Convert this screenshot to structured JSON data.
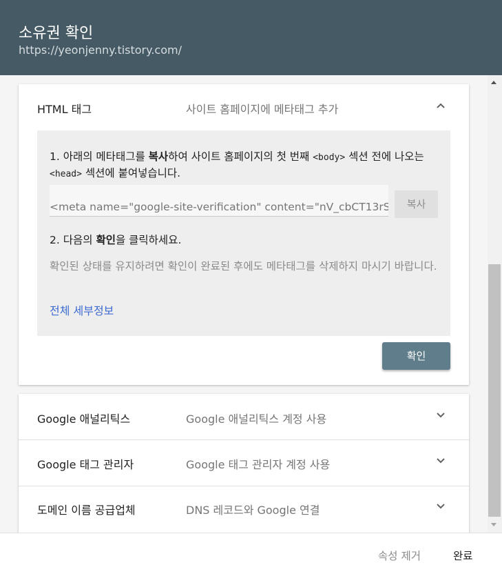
{
  "header": {
    "title": "소유권 확인",
    "url": "https://yeonjenny.tistory.com/"
  },
  "html_tag": {
    "name": "HTML 태그",
    "desc": "사이트 홈페이지에 메타태그 추가",
    "step1_a": "1. 아래의 메타태그를 ",
    "step1_bold": "복사",
    "step1_b": "하여 사이트 홈페이지의 첫 번째 ",
    "step1_code1": "<body>",
    "step1_c": " 섹션 전에 나오는 ",
    "step1_code2": "<head>",
    "step1_d": " 섹션에 붙여넣습니다.",
    "meta_value": "<meta name=\"google-site-verification\" content=\"nV_cbCT13rS",
    "copy_label": "복사",
    "step2_a": "2. 다음의 ",
    "step2_bold": "확인",
    "step2_b": "을 클릭하세요.",
    "note": "확인된 상태를 유지하려면 확인이 완료된 후에도 메타태그를 삭제하지 마시기 바랍니다.",
    "details_link": "전체 세부정보",
    "confirm_label": "확인"
  },
  "methods": [
    {
      "name": "Google 애널리틱스",
      "desc": "Google 애널리틱스 계정 사용"
    },
    {
      "name": "Google 태그 관리자",
      "desc": "Google 태그 관리자 계정 사용"
    },
    {
      "name": "도메인 이름 공급업체",
      "desc": "DNS 레코드와 Google 연결"
    }
  ],
  "footer": {
    "remove_label": "속성 제거",
    "done_label": "완료"
  },
  "colors": {
    "header_bg": "#455a64",
    "confirm_bg": "#607d8b",
    "link": "#3d6bd1"
  },
  "icons": {
    "expanded": "chevron-up-icon",
    "collapsed": "chevron-down-icon"
  }
}
